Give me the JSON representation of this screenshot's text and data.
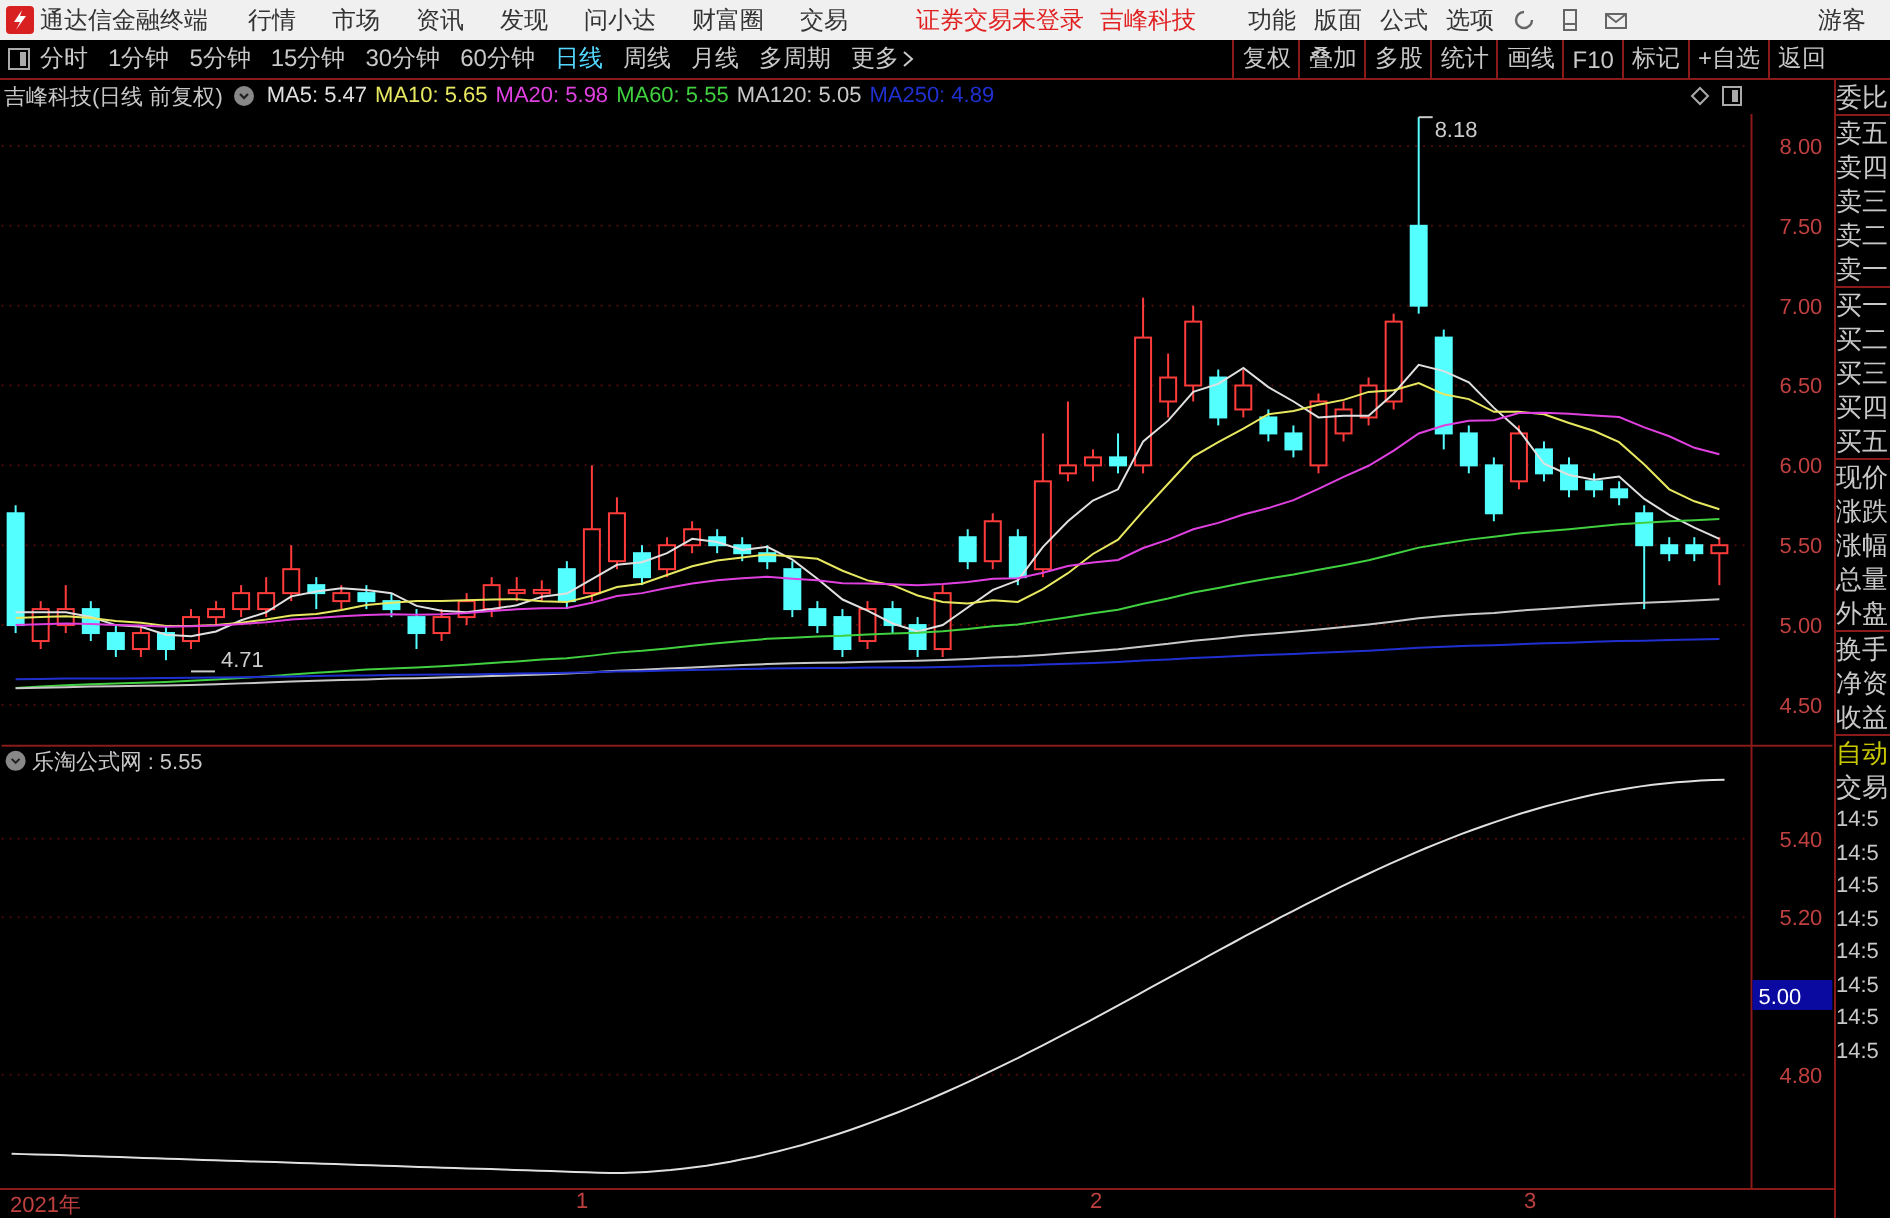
{
  "menubar": {
    "app_title": "通达信金融终端",
    "menus": [
      "行情",
      "市场",
      "资讯",
      "发现",
      "问小达",
      "财富圈",
      "交易"
    ],
    "status_texts": [
      "证券交易未登录",
      "吉峰科技"
    ],
    "tools": [
      "功能",
      "版面",
      "公式",
      "选项"
    ],
    "user": "游客"
  },
  "toolbar": {
    "periods": [
      {
        "label": "分时",
        "selected": false
      },
      {
        "label": "1分钟",
        "selected": false
      },
      {
        "label": "5分钟",
        "selected": false
      },
      {
        "label": "15分钟",
        "selected": false
      },
      {
        "label": "30分钟",
        "selected": false
      },
      {
        "label": "60分钟",
        "selected": false
      },
      {
        "label": "日线",
        "selected": true
      },
      {
        "label": "周线",
        "selected": false
      },
      {
        "label": "月线",
        "selected": false
      },
      {
        "label": "多周期",
        "selected": false
      }
    ],
    "more": "更多",
    "buttons": [
      "复权",
      "叠加",
      "多股",
      "统计",
      "画线",
      "F10",
      "标记",
      "+自选",
      "返回"
    ]
  },
  "chart": {
    "title": "吉峰科技(日线 前复权)",
    "ma_lines": [
      {
        "label": "MA5: 5.47",
        "color": "#e0e0e0"
      },
      {
        "label": "MA10: 5.65",
        "color": "#e8e860"
      },
      {
        "label": "MA20: 5.98",
        "color": "#e040e0"
      },
      {
        "label": "MA60: 5.55",
        "color": "#40d040"
      },
      {
        "label": "MA120: 5.05",
        "color": "#c8c8c8"
      },
      {
        "label": "MA250: 4.89",
        "color": "#2030d0"
      }
    ],
    "price_ticks": [
      "8.00",
      "7.50",
      "7.00",
      "6.50",
      "6.00",
      "5.50",
      "5.00",
      "4.50"
    ],
    "high_label": "8.18",
    "low_label": "4.71",
    "indicator": {
      "title": "乐淘公式网 : 5.55",
      "ticks": [
        "5.40",
        "5.20",
        "4.80"
      ],
      "cursor_value": "5.00"
    },
    "date_axis": [
      "2021年",
      "1",
      "2",
      "3"
    ]
  },
  "quote_panel": {
    "groups": [
      [
        "委比"
      ],
      [
        "卖五",
        "卖四",
        "卖三",
        "卖二",
        "卖一"
      ],
      [
        "买一",
        "买二",
        "买三",
        "买四",
        "买五"
      ],
      [
        "现价",
        "涨跌",
        "涨幅",
        "总量",
        "外盘"
      ],
      [
        "换手",
        "净资",
        "收益"
      ]
    ],
    "auto": "自动",
    "trade": "交易",
    "times": [
      "14:5",
      "14:5",
      "14:5",
      "14:5",
      "14:5",
      "14:5",
      "14:5",
      "14:5"
    ]
  }
}
